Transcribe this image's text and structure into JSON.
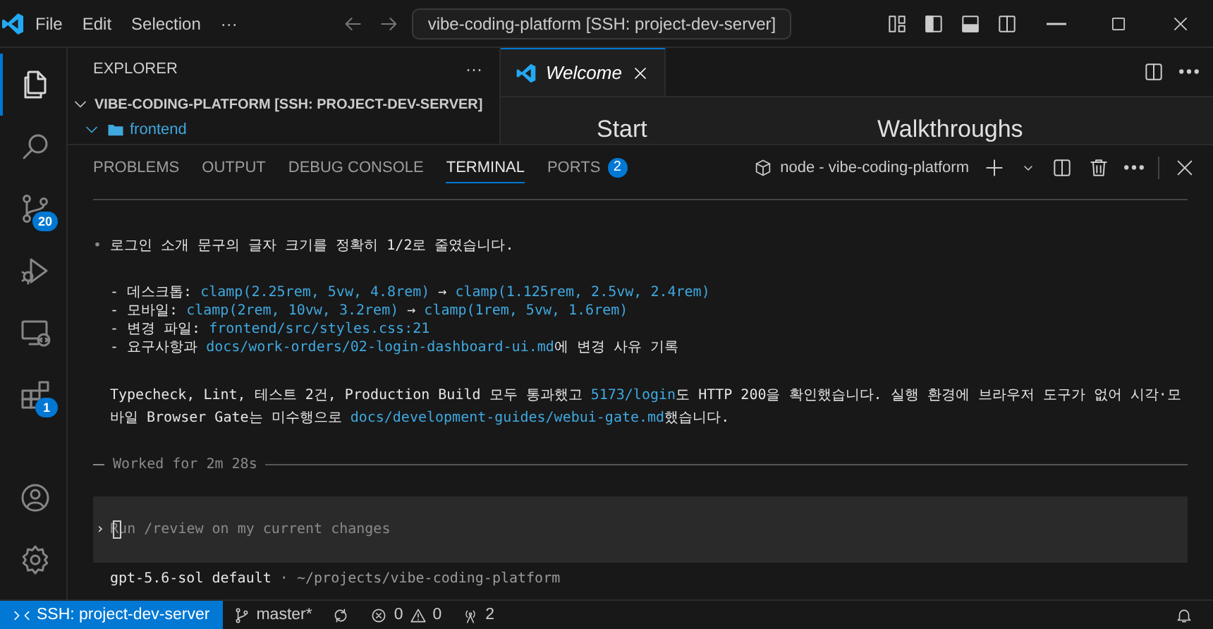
{
  "title_bar": {
    "menu": [
      "File",
      "Edit",
      "Selection",
      "···"
    ],
    "command_center": "vibe-coding-platform [SSH: project-dev-server]"
  },
  "activity_bar": {
    "items": [
      {
        "kind": "explorer",
        "selected": true
      },
      {
        "kind": "search",
        "selected": false
      },
      {
        "kind": "source_control",
        "selected": false,
        "badge": "20"
      },
      {
        "kind": "run_debug",
        "selected": false
      },
      {
        "kind": "remote",
        "selected": false
      },
      {
        "kind": "extensions",
        "selected": false,
        "badge": "1"
      },
      {
        "kind": "account",
        "selected": false
      },
      {
        "kind": "settings",
        "selected": false
      }
    ]
  },
  "sidebar": {
    "title": "EXPLORER",
    "more": "···",
    "root": {
      "label": "VIBE-CODING-PLATFORM [SSH: PROJECT-DEV-SERVER]",
      "expanded": true
    },
    "items": [
      {
        "label": "frontend",
        "expanded": true
      }
    ]
  },
  "editor": {
    "tabs": [
      {
        "label": "Welcome",
        "selected": true
      }
    ],
    "headings": [
      "Start",
      "Walkthroughs"
    ]
  },
  "panel": {
    "tabs": [
      {
        "label": "PROBLEMS",
        "selected": false
      },
      {
        "label": "OUTPUT",
        "selected": false
      },
      {
        "label": "DEBUG CONSOLE",
        "selected": false
      },
      {
        "label": "TERMINAL",
        "selected": true
      },
      {
        "label": "PORTS",
        "selected": false,
        "badge": "2"
      }
    ],
    "terminal_name": "node - vibe-coding-platform",
    "terminal": {
      "blocks": [
        {
          "kind": "bullet",
          "bullet": "•",
          "parts": [
            {
              "kind": "plain",
              "text": "로그인 소개 문구의 글자 크기를 정확히 1/2로 줄였습니다."
            }
          ]
        },
        {
          "kind": "list",
          "lines": [
            [
              {
                "kind": "plain",
                "text": "- 데스크톱: "
              },
              {
                "kind": "path",
                "text": "clamp(2.25rem, 5vw, 4.8rem)"
              },
              {
                "kind": "plain",
                "text": " → "
              },
              {
                "kind": "path",
                "text": "clamp(1.125rem, 2.5vw, 2.4rem)"
              }
            ],
            [
              {
                "kind": "plain",
                "text": "- 모바일: "
              },
              {
                "kind": "path",
                "text": "clamp(2rem, 10vw, 3.2rem)"
              },
              {
                "kind": "plain",
                "text": " → "
              },
              {
                "kind": "path",
                "text": "clamp(1rem, 5vw, 1.6rem)"
              }
            ],
            [
              {
                "kind": "plain",
                "text": "- 변경 파일: "
              },
              {
                "kind": "path",
                "text": "frontend/src/styles.css:21"
              }
            ],
            [
              {
                "kind": "plain",
                "text": "- 요구사항과 "
              },
              {
                "kind": "path",
                "text": "docs/work-orders/02-login-dashboard-ui.md"
              },
              {
                "kind": "plain",
                "text": "에 변경 사유 기록"
              }
            ]
          ]
        },
        {
          "kind": "paragraph",
          "parts": [
            {
              "kind": "plain",
              "text": "Typecheck, Lint, 테스트 2건, Production Build 모두 통과했고 "
            },
            {
              "kind": "path",
              "text": "5173/login"
            },
            {
              "kind": "plain",
              "text": "도 HTTP 200을 확인했습니다. 실행 환경에 브라우저 도구가 없어 시각·모바일 Browser Gate는 미수행으로 "
            },
            {
              "kind": "path",
              "text": "docs/development-guides/webui-gate.md"
            },
            {
              "kind": "plain",
              "text": "했습니다."
            }
          ]
        }
      ],
      "worked": "Worked for 2m 28s",
      "input": {
        "prompt": "›",
        "placeholder": "Run /review on my current changes"
      },
      "footer": {
        "model": "gpt-5.6-sol default",
        "separator": "·",
        "path": "~/projects/vibe-coding-platform"
      }
    }
  },
  "status_bar": {
    "remote": "SSH: project-dev-server",
    "branch": "master*",
    "errors": "0",
    "warnings": "0",
    "ports": "2"
  }
}
